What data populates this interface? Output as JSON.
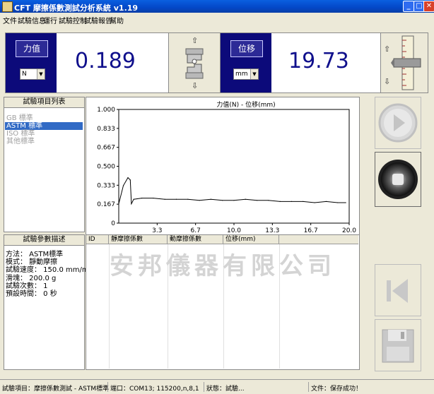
{
  "window": {
    "title": "CFT 摩擦係數測試分析系統 v1.19"
  },
  "menu": [
    "文件",
    "試驗信息",
    "運行",
    "試驗控制",
    "試驗報告",
    "幫助"
  ],
  "force": {
    "label": "力值",
    "unit": "N",
    "value": "0.189"
  },
  "displacement": {
    "label": "位移",
    "unit": "mm",
    "value": "19.73"
  },
  "test_items": {
    "header": "試驗項目列表",
    "items": [
      "GB 標準",
      "ASTM 標準",
      "ISO 標準",
      "其他標準"
    ],
    "selected_index": 1
  },
  "params": {
    "header": "試驗參數描述",
    "lines": [
      "方法： ASTM標準",
      "模式： 靜動摩擦",
      "試驗速度： 150.0 mm/min",
      "滑塊： 200.0 g",
      "試驗次數： 1",
      "預設時間： 0 秒"
    ]
  },
  "chart_data": {
    "type": "line",
    "title": "力值(N) - 位移(mm)",
    "xlabel": "",
    "ylabel": "",
    "xlim": [
      0,
      20
    ],
    "ylim": [
      0,
      1
    ],
    "x_ticks": [
      "3.3",
      "6.7",
      "10.0",
      "13.3",
      "16.7",
      "20.0"
    ],
    "y_ticks": [
      "1.000",
      "0.833",
      "0.667",
      "0.500",
      "0.333",
      "0.167",
      "0"
    ],
    "series": [
      {
        "color": "#000000",
        "x": [
          0,
          0.4,
          0.8,
          1.0,
          1.1,
          1.3,
          2,
          3,
          4,
          5,
          6,
          7,
          8,
          9,
          10,
          11,
          12,
          13,
          14,
          15,
          16,
          17,
          18,
          19,
          19.7
        ],
        "y": [
          0.17,
          0.33,
          0.4,
          0.38,
          0.17,
          0.21,
          0.22,
          0.22,
          0.21,
          0.21,
          0.21,
          0.2,
          0.21,
          0.2,
          0.2,
          0.21,
          0.2,
          0.2,
          0.19,
          0.19,
          0.19,
          0.18,
          0.19,
          0.18,
          0.18
        ]
      }
    ]
  },
  "table": {
    "columns": [
      "ID",
      "靜摩擦係數",
      "動摩擦係數",
      "位移(mm)"
    ],
    "watermark": "安邦儀器有限公司"
  },
  "statusbar": {
    "item": "試驗項目：摩擦係數測試 - ASTM標準",
    "port": "端口：COM13;  115200,n,8,1",
    "state": "狀態：試驗...",
    "file": "文件：保存成功！"
  }
}
